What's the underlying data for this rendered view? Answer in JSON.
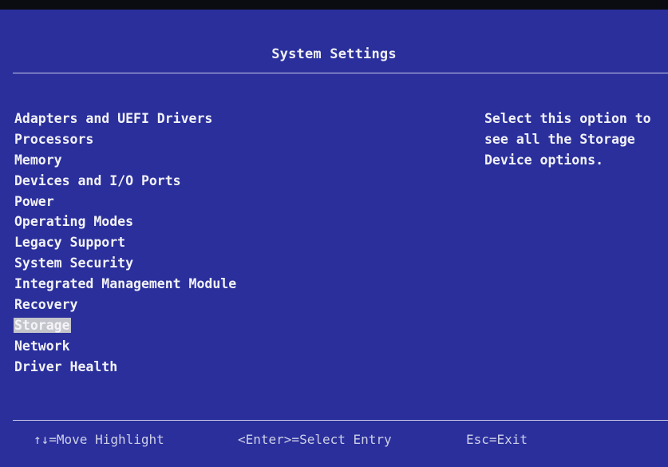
{
  "header": {
    "title": "System Settings"
  },
  "menu": {
    "items": [
      "Adapters and UEFI Drivers",
      "Processors",
      "Memory",
      "Devices and I/O Ports",
      "Power",
      "Operating Modes",
      "Legacy Support",
      "System Security",
      "Integrated Management Module",
      "Recovery",
      "Storage",
      "Network",
      "Driver Health"
    ],
    "selected": "Storage"
  },
  "help": {
    "lines": [
      "Select this option to",
      "see all the Storage",
      "Device options."
    ]
  },
  "footer": {
    "move": "↑↓=Move Highlight",
    "enter": "<Enter>=Select Entry",
    "exit": "Esc=Exit"
  },
  "colors": {
    "background": "#2a2f9c",
    "text": "#f2f2f6",
    "highlight": "#c4c4cc"
  }
}
